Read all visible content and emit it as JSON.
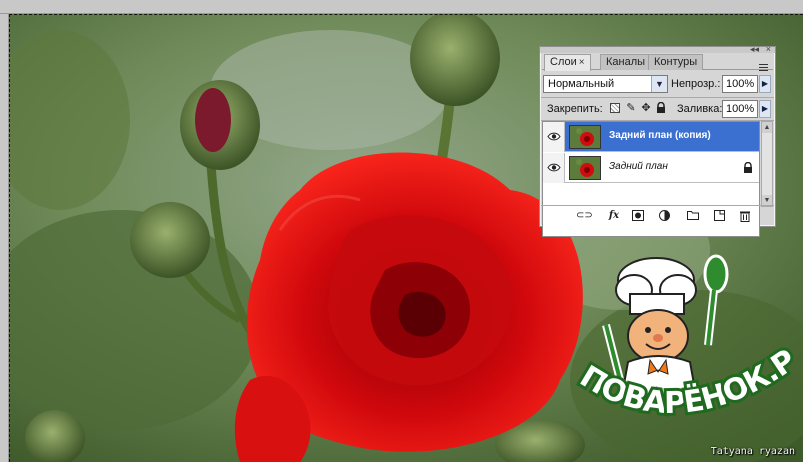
{
  "layers_panel": {
    "tabs": [
      {
        "label": "Слои",
        "active": true
      },
      {
        "label": "Каналы",
        "active": false
      },
      {
        "label": "Контуры",
        "active": false
      }
    ],
    "tab_close_glyph": "×",
    "blend_mode": "Нормальный",
    "opacity_label": "Непрозр.:",
    "opacity_value": "100%",
    "lock_label": "Закрепить:",
    "fill_label": "Заливка:",
    "fill_value": "100%",
    "layers": [
      {
        "name": "Задний план (копия)",
        "selected": true,
        "visible": true,
        "locked": false
      },
      {
        "name": "Задний план",
        "selected": false,
        "visible": true,
        "locked": true
      }
    ],
    "footer_icons": [
      "link-icon",
      "fx-icon",
      "mask-icon",
      "adjustment-icon",
      "group-folder-icon",
      "new-layer-icon",
      "trash-icon"
    ],
    "accent_color": "#3b6fd0"
  },
  "watermark": {
    "brand": "ПОВАРЁНОК.РУ",
    "credit": "Tatyana ryazan"
  }
}
